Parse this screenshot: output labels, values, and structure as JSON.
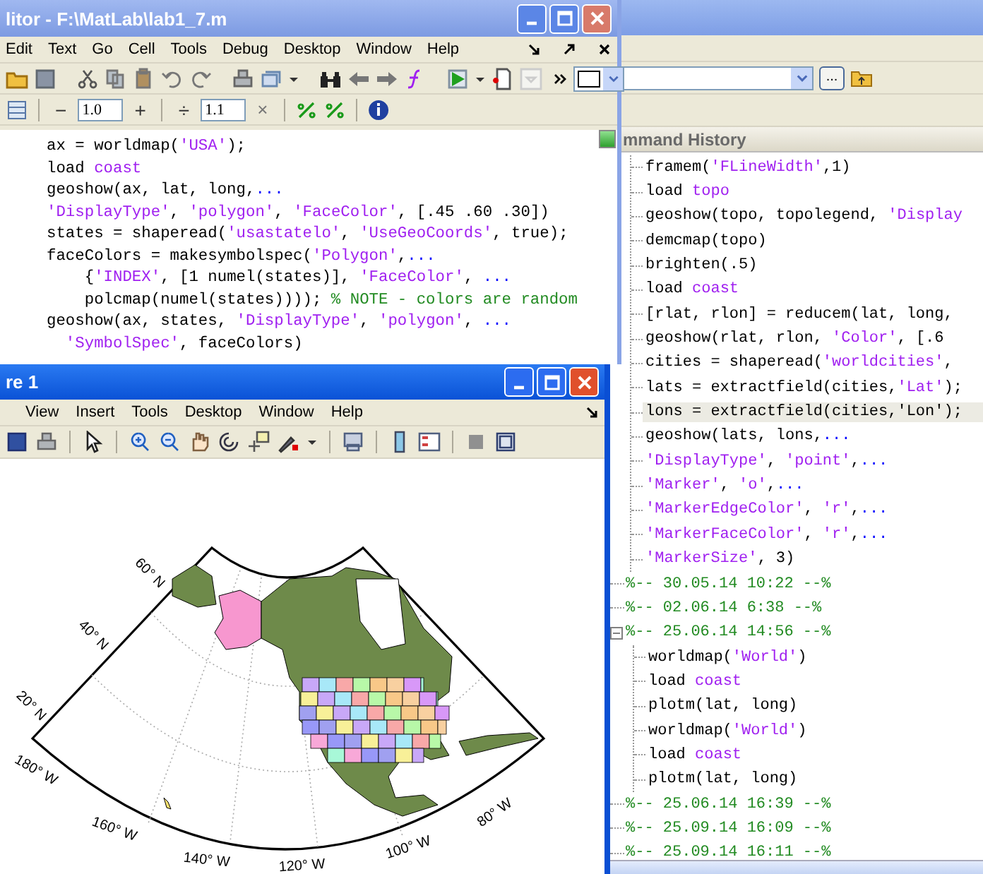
{
  "editor": {
    "title": "litor - F:\\MatLab\\lab1_7.m",
    "menu": [
      "Edit",
      "Text",
      "Go",
      "Cell",
      "Tools",
      "Debug",
      "Desktop",
      "Window",
      "Help"
    ],
    "cell_toolbar": {
      "minus": "−",
      "decrement_value": "1.0",
      "plus": "+",
      "divide": "÷",
      "divide_value": "1.1",
      "times": "×"
    },
    "code": [
      [
        {
          "kind": "plain",
          "text": "ax = worldmap("
        },
        {
          "kind": "string",
          "text": "'USA'"
        },
        {
          "kind": "plain",
          "text": ");"
        }
      ],
      [
        {
          "kind": "plain",
          "text": "load "
        },
        {
          "kind": "string",
          "text": "coast"
        }
      ],
      [
        {
          "kind": "plain",
          "text": "geoshow(ax, lat, long,"
        },
        {
          "kind": "continuation",
          "text": "..."
        }
      ],
      [
        {
          "kind": "string",
          "text": "'DisplayType'"
        },
        {
          "kind": "plain",
          "text": ", "
        },
        {
          "kind": "string",
          "text": "'polygon'"
        },
        {
          "kind": "plain",
          "text": ", "
        },
        {
          "kind": "string",
          "text": "'FaceColor'"
        },
        {
          "kind": "plain",
          "text": ", [.45 .60 .30])"
        }
      ],
      [
        {
          "kind": "plain",
          "text": "states = shaperead("
        },
        {
          "kind": "string",
          "text": "'usastatelo'"
        },
        {
          "kind": "plain",
          "text": ", "
        },
        {
          "kind": "string",
          "text": "'UseGeoCoords'"
        },
        {
          "kind": "plain",
          "text": ", true);"
        }
      ],
      [
        {
          "kind": "plain",
          "text": "faceColors = makesymbolspec("
        },
        {
          "kind": "string",
          "text": "'Polygon'"
        },
        {
          "kind": "plain",
          "text": ","
        },
        {
          "kind": "continuation",
          "text": "..."
        }
      ],
      [
        {
          "kind": "plain",
          "text": "    {"
        },
        {
          "kind": "string",
          "text": "'INDEX'"
        },
        {
          "kind": "plain",
          "text": ", [1 numel(states)], "
        },
        {
          "kind": "string",
          "text": "'FaceColor'"
        },
        {
          "kind": "plain",
          "text": ", "
        },
        {
          "kind": "continuation",
          "text": "..."
        }
      ],
      [
        {
          "kind": "plain",
          "text": "    polcmap(numel(states)))); "
        },
        {
          "kind": "comment",
          "text": "% NOTE - colors are random"
        }
      ],
      [
        {
          "kind": "plain",
          "text": "geoshow(ax, states, "
        },
        {
          "kind": "string",
          "text": "'DisplayType'"
        },
        {
          "kind": "plain",
          "text": ", "
        },
        {
          "kind": "string",
          "text": "'polygon'"
        },
        {
          "kind": "plain",
          "text": ", "
        },
        {
          "kind": "continuation",
          "text": "..."
        }
      ],
      [
        {
          "kind": "string",
          "text": "  'SymbolSpec'"
        },
        {
          "kind": "plain",
          "text": ", faceColors)"
        }
      ]
    ]
  },
  "figure": {
    "title": "re 1",
    "menu": [
      "View",
      "Insert",
      "Tools",
      "Desktop",
      "Window",
      "Help"
    ],
    "map": {
      "latitude_labels": [
        "60° N",
        "40° N",
        "20° N"
      ],
      "longitude_labels": [
        "180° W",
        "160° W",
        "140° W",
        "120° W",
        "100° W",
        "80° W"
      ]
    }
  },
  "main_window": {
    "browse_button": "...",
    "command_history": {
      "title": "mmand History",
      "sessions": [
        {
          "children": [
            {
              "selected": false,
              "parts": [
                {
                  "kind": "plain",
                  "text": "framem("
                },
                {
                  "kind": "string",
                  "text": "'FLineWidth'"
                },
                {
                  "kind": "plain",
                  "text": ",1)"
                }
              ]
            },
            {
              "selected": false,
              "parts": [
                {
                  "kind": "plain",
                  "text": "load "
                },
                {
                  "kind": "string",
                  "text": "topo"
                }
              ]
            },
            {
              "selected": false,
              "parts": [
                {
                  "kind": "plain",
                  "text": "geoshow(topo, topolegend, "
                },
                {
                  "kind": "string",
                  "text": "'Display"
                }
              ]
            },
            {
              "selected": false,
              "parts": [
                {
                  "kind": "plain",
                  "text": "demcmap(topo)"
                }
              ]
            },
            {
              "selected": false,
              "parts": [
                {
                  "kind": "plain",
                  "text": "brighten(.5)"
                }
              ]
            },
            {
              "selected": false,
              "parts": [
                {
                  "kind": "plain",
                  "text": "load "
                },
                {
                  "kind": "string",
                  "text": "coast"
                }
              ]
            },
            {
              "selected": false,
              "parts": [
                {
                  "kind": "plain",
                  "text": "[rlat, rlon] = reducem(lat, long,"
                }
              ]
            },
            {
              "selected": false,
              "parts": [
                {
                  "kind": "plain",
                  "text": "geoshow(rlat, rlon, "
                },
                {
                  "kind": "string",
                  "text": "'Color'"
                },
                {
                  "kind": "plain",
                  "text": ", [.6"
                }
              ]
            },
            {
              "selected": false,
              "parts": [
                {
                  "kind": "plain",
                  "text": "cities = shaperead("
                },
                {
                  "kind": "string",
                  "text": "'worldcities'"
                },
                {
                  "kind": "plain",
                  "text": ","
                }
              ]
            },
            {
              "selected": false,
              "parts": [
                {
                  "kind": "plain",
                  "text": "lats = extractfield(cities,"
                },
                {
                  "kind": "string",
                  "text": "'Lat'"
                },
                {
                  "kind": "plain",
                  "text": ");"
                }
              ]
            },
            {
              "selected": true,
              "parts": [
                {
                  "kind": "plain",
                  "text": "lons = extractfield(cities,'Lon');"
                }
              ]
            },
            {
              "selected": false,
              "parts": [
                {
                  "kind": "plain",
                  "text": "geoshow(lats, lons,"
                },
                {
                  "kind": "continuation",
                  "text": "..."
                }
              ]
            },
            {
              "selected": false,
              "parts": [
                {
                  "kind": "string",
                  "text": "'DisplayType'"
                },
                {
                  "kind": "plain",
                  "text": ", "
                },
                {
                  "kind": "string",
                  "text": "'point'"
                },
                {
                  "kind": "plain",
                  "text": ","
                },
                {
                  "kind": "continuation",
                  "text": "..."
                }
              ]
            },
            {
              "selected": false,
              "parts": [
                {
                  "kind": "string",
                  "text": "'Marker'"
                },
                {
                  "kind": "plain",
                  "text": ", "
                },
                {
                  "kind": "string",
                  "text": "'o'"
                },
                {
                  "kind": "plain",
                  "text": ","
                },
                {
                  "kind": "continuation",
                  "text": "..."
                }
              ]
            },
            {
              "selected": false,
              "parts": [
                {
                  "kind": "string",
                  "text": "'MarkerEdgeColor'"
                },
                {
                  "kind": "plain",
                  "text": ", "
                },
                {
                  "kind": "string",
                  "text": "'r'"
                },
                {
                  "kind": "plain",
                  "text": ","
                },
                {
                  "kind": "continuation",
                  "text": "..."
                }
              ]
            },
            {
              "selected": false,
              "parts": [
                {
                  "kind": "string",
                  "text": "'MarkerFaceColor'"
                },
                {
                  "kind": "plain",
                  "text": ", "
                },
                {
                  "kind": "string",
                  "text": "'r'"
                },
                {
                  "kind": "plain",
                  "text": ","
                },
                {
                  "kind": "continuation",
                  "text": "..."
                }
              ]
            },
            {
              "selected": false,
              "parts": [
                {
                  "kind": "string",
                  "text": "'MarkerSize'"
                },
                {
                  "kind": "plain",
                  "text": ", 3)"
                }
              ]
            }
          ]
        },
        {
          "header": "%-- 30.05.14 10:22 --%"
        },
        {
          "header": "%-- 02.06.14 6:38 --%"
        },
        {
          "header": "%-- 25.06.14 14:56 --%",
          "children": [
            {
              "selected": false,
              "parts": [
                {
                  "kind": "plain",
                  "text": "worldmap("
                },
                {
                  "kind": "string",
                  "text": "'World'"
                },
                {
                  "kind": "plain",
                  "text": ")"
                }
              ]
            },
            {
              "selected": false,
              "parts": [
                {
                  "kind": "plain",
                  "text": "load "
                },
                {
                  "kind": "string",
                  "text": "coast"
                }
              ]
            },
            {
              "selected": false,
              "parts": [
                {
                  "kind": "plain",
                  "text": "plotm(lat, long)"
                }
              ]
            },
            {
              "selected": false,
              "parts": [
                {
                  "kind": "plain",
                  "text": "worldmap("
                },
                {
                  "kind": "string",
                  "text": "'World'"
                },
                {
                  "kind": "plain",
                  "text": ")"
                }
              ]
            },
            {
              "selected": false,
              "parts": [
                {
                  "kind": "plain",
                  "text": "load "
                },
                {
                  "kind": "string",
                  "text": "coast"
                }
              ]
            },
            {
              "selected": false,
              "parts": [
                {
                  "kind": "plain",
                  "text": "plotm(lat, long)"
                }
              ]
            }
          ]
        },
        {
          "header": "%-- 25.06.14 16:39 --%"
        },
        {
          "header": "%-- 25.09.14 16:09 --%"
        },
        {
          "header": "%-- 25.09.14 16:11 --%"
        }
      ]
    }
  }
}
